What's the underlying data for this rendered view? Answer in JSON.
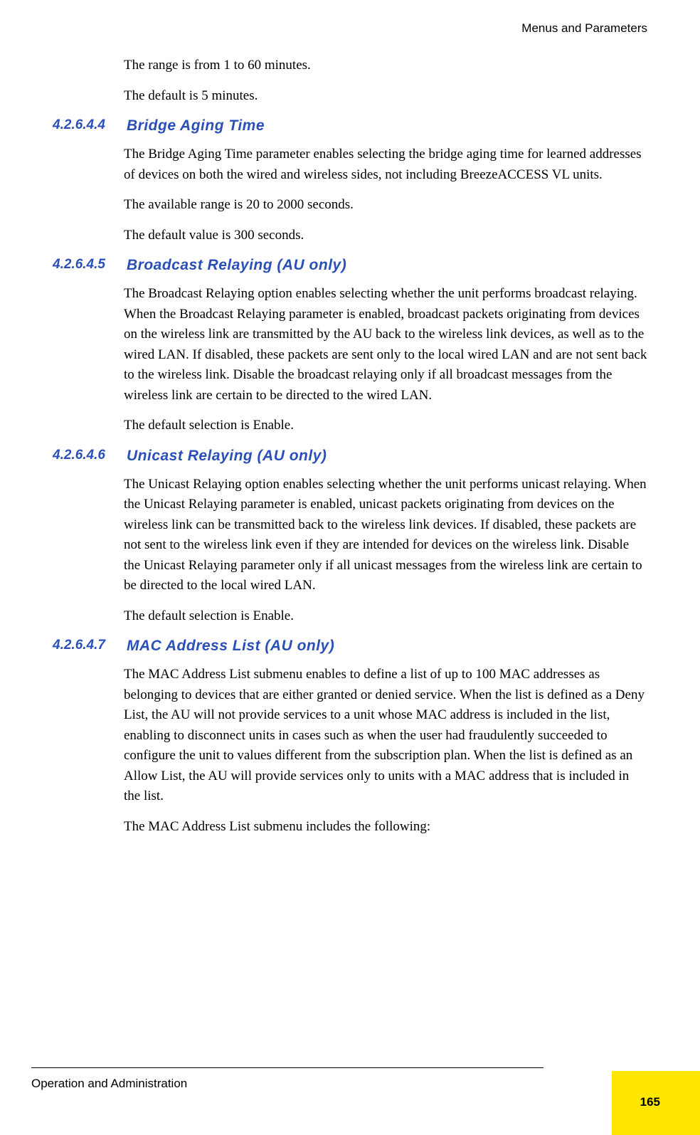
{
  "header": {
    "running_title": "Menus and Parameters"
  },
  "intro": {
    "range": "The range is from 1 to 60 minutes.",
    "default": "The default is 5 minutes."
  },
  "sections": [
    {
      "number": "4.2.6.4.4",
      "title": "Bridge Aging Time",
      "paras": [
        "The Bridge Aging Time parameter enables selecting the bridge aging time for learned addresses of devices on both the wired and wireless sides, not including BreezeACCESS VL units.",
        "The available range is 20 to 2000 seconds.",
        "The default value is 300 seconds."
      ]
    },
    {
      "number": "4.2.6.4.5",
      "title": "Broadcast Relaying (AU only)",
      "paras": [
        "The Broadcast Relaying option enables selecting whether the unit performs broadcast relaying. When the Broadcast Relaying parameter is enabled, broadcast packets originating from devices on the wireless link are transmitted by the AU back to the wireless link devices, as well as to the wired LAN. If disabled, these packets are sent only to the local wired LAN and are not sent back to the wireless link. Disable the broadcast relaying only if all broadcast messages from the wireless link are certain to be directed to the wired LAN.",
        "The default selection is Enable."
      ]
    },
    {
      "number": "4.2.6.4.6",
      "title": "Unicast Relaying (AU only)",
      "paras": [
        "The Unicast Relaying option enables selecting whether the unit performs unicast relaying. When the Unicast Relaying parameter is enabled, unicast packets originating from devices on the wireless link can be transmitted back to the wireless link devices. If disabled, these packets are not sent to the wireless link even if they are intended for devices on the wireless link. Disable the Unicast Relaying parameter only if all unicast messages from the wireless link are certain to be directed to the local wired LAN.",
        "The default selection is Enable."
      ]
    },
    {
      "number": "4.2.6.4.7",
      "title": "MAC Address List (AU only)",
      "paras": [
        "The MAC Address List submenu enables to define a list of up to 100 MAC addresses as belonging to devices that are either granted or denied service. When the list is defined as a Deny List, the AU will not provide services to a unit whose MAC address is included in the list, enabling to disconnect units in cases such as when the user had fraudulently succeeded to configure the unit to values different from the subscription plan. When the list is defined as an Allow List, the AU will provide services only to units with a MAC address that is included in the list.",
        "The MAC Address List submenu includes the following:"
      ]
    }
  ],
  "footer": {
    "left": "Operation and Administration",
    "page_number": "165"
  }
}
